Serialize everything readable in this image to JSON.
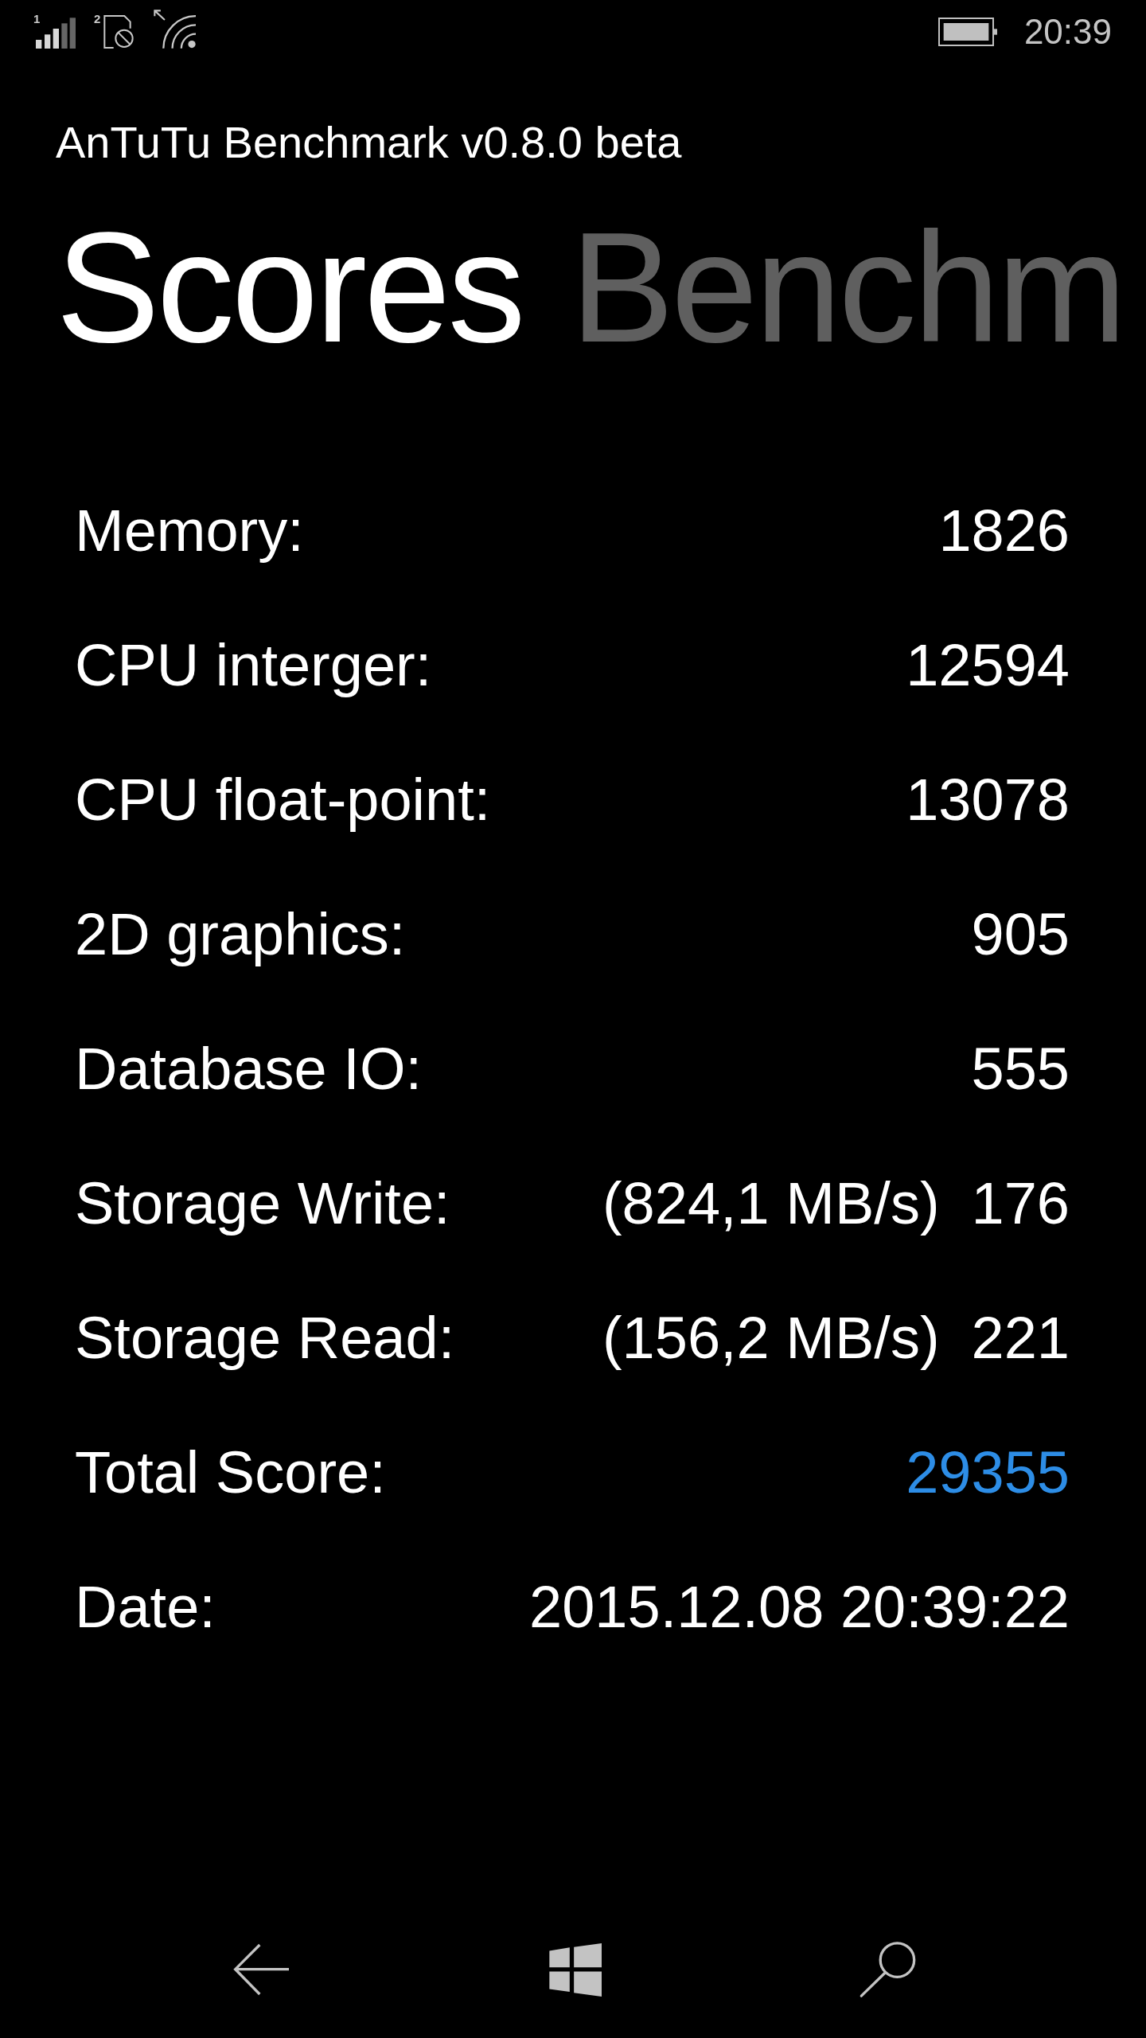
{
  "status_bar": {
    "signal_slot": "1",
    "sim_slot": "2",
    "time": "20:39"
  },
  "app_title": "AnTuTu Benchmark v0.8.0 beta",
  "pivot_tabs": [
    {
      "label": "Scores",
      "selected": true
    },
    {
      "label": "Benchm",
      "selected": false
    }
  ],
  "results": [
    {
      "kind": "regular",
      "label": "Memory:",
      "value": "1826"
    },
    {
      "kind": "regular",
      "label": "CPU interger:",
      "value": "12594"
    },
    {
      "kind": "regular",
      "label": "CPU float-point:",
      "value": "13078"
    },
    {
      "kind": "regular",
      "label": "2D graphics:",
      "value": "905"
    },
    {
      "kind": "regular",
      "label": "Database IO:",
      "value": "555"
    },
    {
      "kind": "regular",
      "label": "Storage Write:",
      "rate": "(824,1 MB/s)",
      "value": "176"
    },
    {
      "kind": "regular",
      "label": "Storage Read:",
      "rate": "(156,2 MB/s)",
      "value": "221"
    },
    {
      "kind": "total",
      "label": "Total Score:",
      "value": "29355"
    },
    {
      "kind": "regular",
      "label": "Date:",
      "value": "2015.12.08 20:39:22"
    }
  ]
}
